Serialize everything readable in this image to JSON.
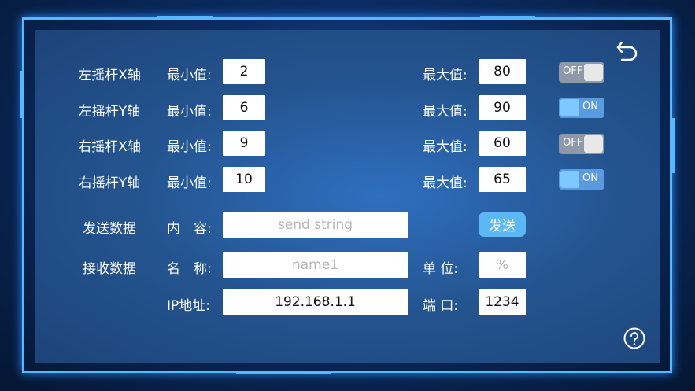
{
  "rows": [
    {
      "name": "左摇杆X轴",
      "min_label": "最小值:",
      "min": "2",
      "max_label": "最大值:",
      "max": "80",
      "toggle": "OFF"
    },
    {
      "name": "左摇杆Y轴",
      "min_label": "最小值:",
      "min": "6",
      "max_label": "最大值:",
      "max": "90",
      "toggle": "ON"
    },
    {
      "name": "右摇杆X轴",
      "min_label": "最小值:",
      "min": "9",
      "max_label": "最大值:",
      "max": "60",
      "toggle": "OFF"
    },
    {
      "name": "右摇杆Y轴",
      "min_label": "最小值:",
      "min": "10",
      "max_label": "最大值:",
      "max": "65",
      "toggle": "ON"
    }
  ],
  "send": {
    "title": "发送数据",
    "content_label": "内　容:",
    "content_placeholder": "send string",
    "button": "发送"
  },
  "receive": {
    "title": "接收数据",
    "name_label": "名　称:",
    "name_placeholder": "name1",
    "unit_label": "单 位:",
    "unit_placeholder": "%"
  },
  "network": {
    "ip_label": "IP地址:",
    "ip": "192.168.1.1",
    "port_label": "端 口:",
    "port": "1234"
  },
  "icons": {
    "back": "undo-arrow-icon",
    "help": "question-circle-icon"
  },
  "colors": {
    "frame": "#58b8ff",
    "button": "#5cb8f5",
    "toggle_on": "#5a9be0",
    "toggle_off": "#8e98a8"
  }
}
